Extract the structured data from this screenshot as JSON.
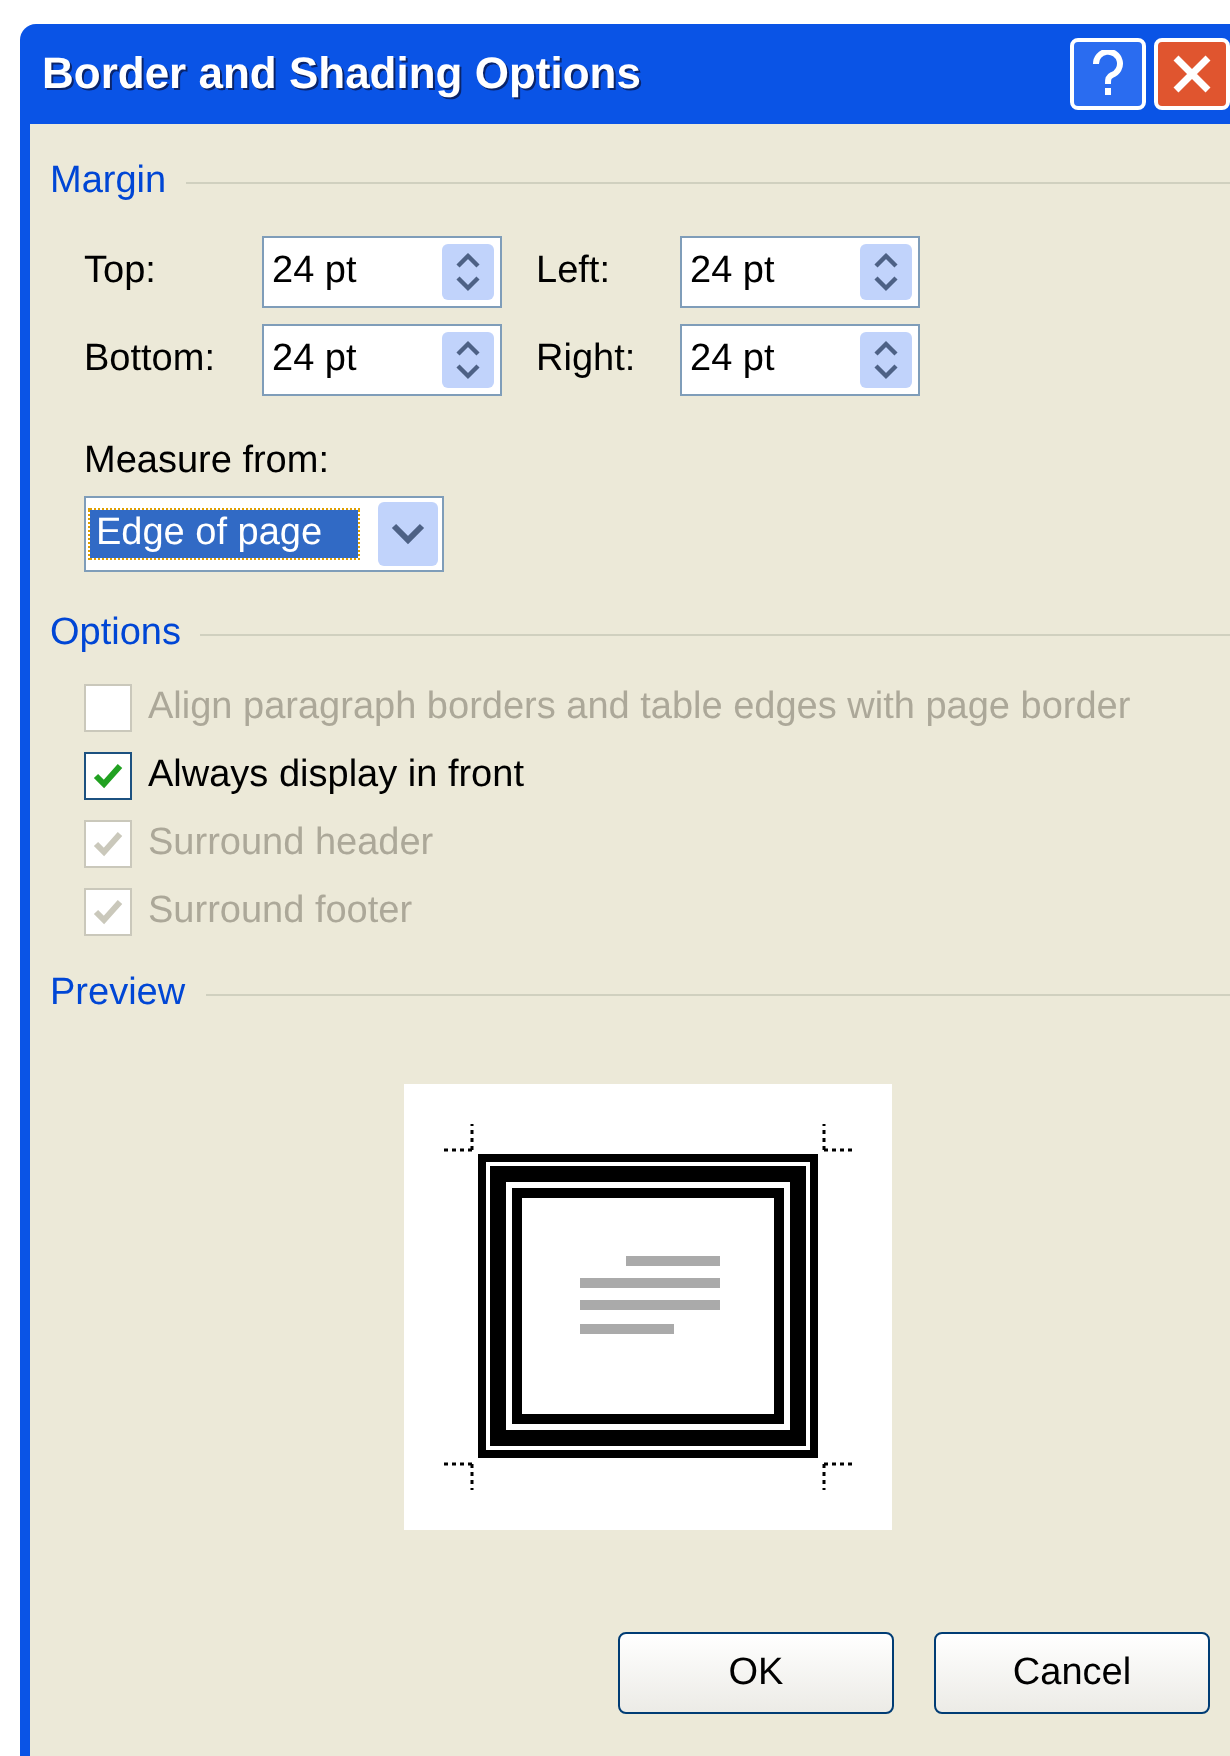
{
  "window": {
    "title": "Border and Shading Options"
  },
  "margin": {
    "heading": "Margin",
    "fields": [
      {
        "label": "Top:",
        "value": "24 pt"
      },
      {
        "label": "Left:",
        "value": "24 pt"
      },
      {
        "label": "Bottom:",
        "value": "24 pt"
      },
      {
        "label": "Right:",
        "value": "24 pt"
      }
    ],
    "measure_label": "Measure from:",
    "measure_value": "Edge of page"
  },
  "options": {
    "heading": "Options",
    "items": [
      {
        "label": "Align paragraph borders and table edges with page border",
        "checked": false,
        "disabled": true
      },
      {
        "label": "Always display in front",
        "checked": true,
        "disabled": false
      },
      {
        "label": "Surround header",
        "checked": true,
        "disabled": true
      },
      {
        "label": "Surround footer",
        "checked": true,
        "disabled": true
      }
    ]
  },
  "preview": {
    "heading": "Preview"
  },
  "buttons": [
    "OK",
    "Cancel"
  ]
}
